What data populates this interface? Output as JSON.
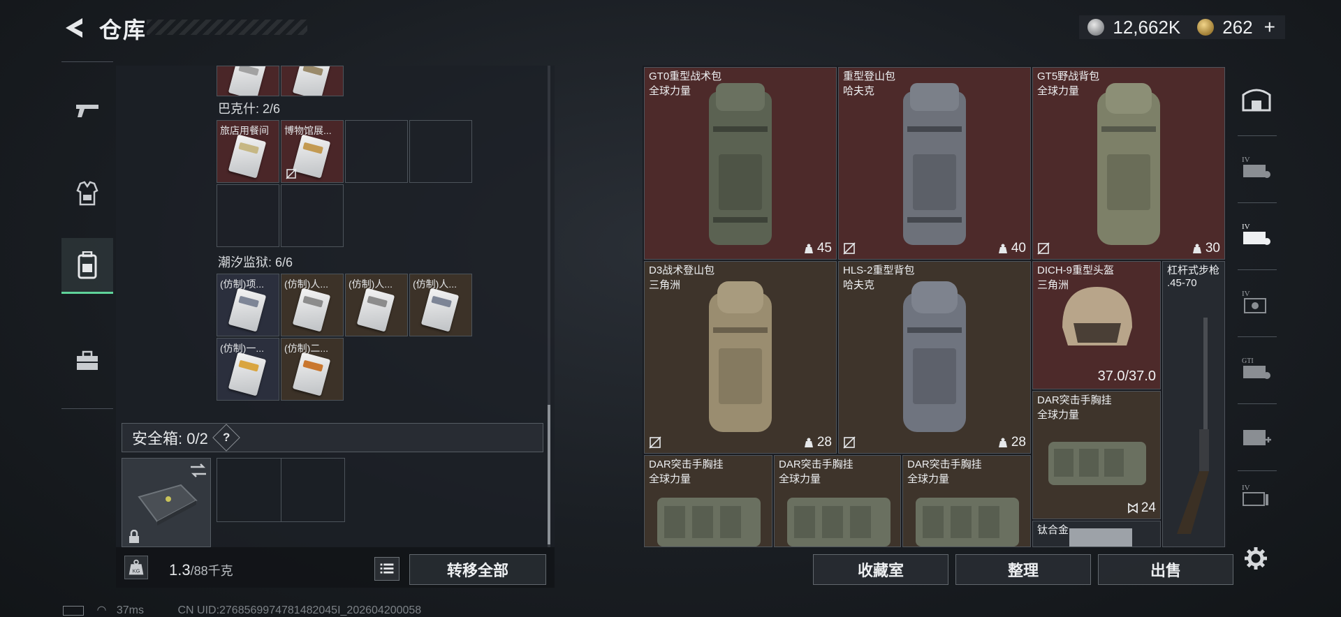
{
  "header": {
    "title": "仓库",
    "silver_amount": "12,662K",
    "gold_amount": "262",
    "add_label": "+"
  },
  "left": {
    "groups": [
      {
        "title": "巴克什: 2/6",
        "items": [
          "旅店用餐间",
          "博物馆展..."
        ]
      },
      {
        "title": "潮汐监狱: 6/6",
        "items": [
          "(仿制)项...",
          "(仿制)人...",
          "(仿制)人...",
          "(仿制)人...",
          "(仿制)一...",
          "(仿制)二..."
        ]
      }
    ],
    "safe_box": "安全箱: 0/2",
    "help": "?",
    "weight_value": "1.3",
    "weight_max": "/88千克",
    "transfer_all": "转移全部"
  },
  "inventory": {
    "items": [
      {
        "name": "GT0重型战术包",
        "sub": "全球力量",
        "count": "45"
      },
      {
        "name": "重型登山包",
        "sub": "哈夫克",
        "count": "40"
      },
      {
        "name": "GT5野战背包",
        "sub": "全球力量",
        "count": "30"
      },
      {
        "name": "D3战术登山包",
        "sub": "三角洲",
        "count": "28"
      },
      {
        "name": "HLS-2重型背包",
        "sub": "哈夫克",
        "count": "28"
      },
      {
        "name": "DICH-9重型头盔",
        "sub": "三角洲",
        "durability": "37.0/37.0"
      },
      {
        "name": "杠杆式步枪",
        "sub": ".45-70"
      },
      {
        "name": "DAR突击手胸挂",
        "sub": "全球力量",
        "count": "24"
      },
      {
        "name": "DAR突击手胸挂",
        "sub": "全球力量"
      },
      {
        "name": "DAR突击手胸挂",
        "sub": "全球力量"
      },
      {
        "name": "DAR突击手胸挂",
        "sub": "全球力量"
      },
      {
        "name": "钛合金",
        "sub": ""
      }
    ],
    "buttons": {
      "collection": "收藏室",
      "sort": "整理",
      "sell": "出售"
    }
  },
  "status": {
    "ping": "37ms",
    "uid": "CN UID:2768569974781482045I_202604200058"
  },
  "colors": {
    "accent_green": "#5fd39a",
    "red_cell": "#4d2a2a",
    "brown_cell": "#3e342b"
  }
}
